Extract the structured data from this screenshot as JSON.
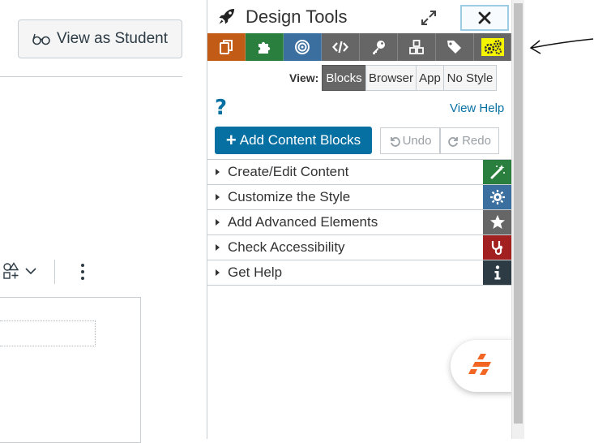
{
  "left": {
    "view_student_label": "View as Student"
  },
  "panel": {
    "title": "Design Tools",
    "toolbar": [
      {
        "name": "copy-tool",
        "icon": "copy-icon",
        "color": "#c15b16"
      },
      {
        "name": "puzzle-tool",
        "icon": "puzzle-icon",
        "color": "#2a7f3e"
      },
      {
        "name": "target-tool",
        "icon": "target-icon",
        "color": "#3a6fa0"
      },
      {
        "name": "code-tool",
        "icon": "code-icon",
        "color": "#666666"
      },
      {
        "name": "key-tool",
        "icon": "key-icon",
        "color": "#666666"
      },
      {
        "name": "cubes-tool",
        "icon": "cubes-icon",
        "color": "#666666"
      },
      {
        "name": "tags-tool",
        "icon": "tags-icon",
        "color": "#666666"
      },
      {
        "name": "gears-tool",
        "icon": "gears-icon",
        "color": "#666666",
        "highlight": "#f5f500"
      }
    ],
    "view": {
      "label": "View:",
      "tabs": [
        "Blocks",
        "Browser",
        "App",
        "No Style"
      ],
      "active": "Blocks"
    },
    "help_symbol": "?",
    "view_help": "View Help",
    "add_content_blocks": "Add Content Blocks",
    "undo": "Undo",
    "redo": "Redo",
    "sections": [
      {
        "label": "Create/Edit Content",
        "icon": "magic-wand-icon",
        "color": "#2a7f3e"
      },
      {
        "label": "Customize the Style",
        "icon": "gear-sun-icon",
        "color": "#3a6fa0"
      },
      {
        "label": "Add Advanced Elements",
        "icon": "star-icon",
        "color": "#666666"
      },
      {
        "label": "Check Accessibility",
        "icon": "stethoscope-icon",
        "color": "#a32020"
      },
      {
        "label": "Get Help",
        "icon": "info-icon",
        "color": "#2d3b45"
      }
    ]
  },
  "colors": {
    "brand_blue": "#0770a3",
    "fab_orange": "#f26522"
  }
}
